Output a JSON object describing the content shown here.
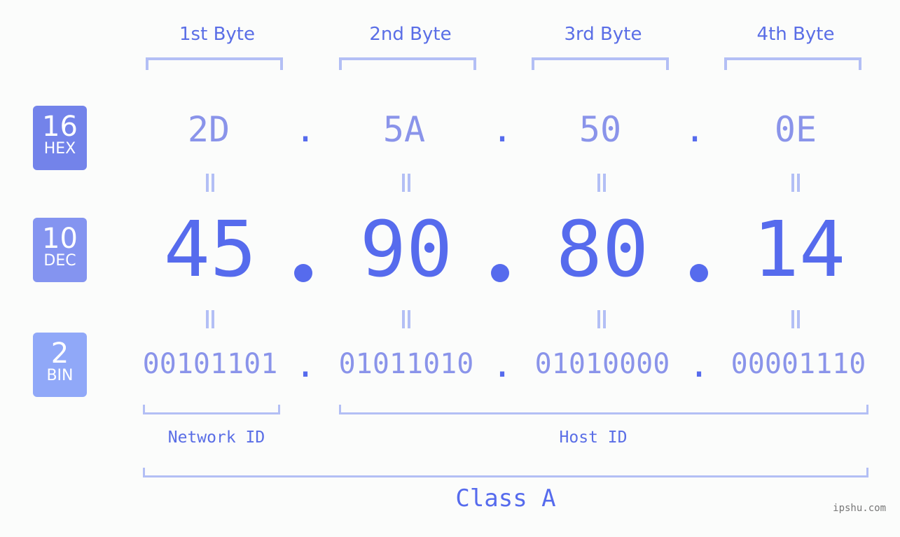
{
  "bytes": [
    {
      "label": "1st Byte",
      "hex": "2D",
      "dec": "45",
      "bin": "00101101"
    },
    {
      "label": "2nd Byte",
      "hex": "5A",
      "dec": "90",
      "bin": "01011010"
    },
    {
      "label": "3rd Byte",
      "hex": "50",
      "dec": "80",
      "bin": "01010000"
    },
    {
      "label": "4th Byte",
      "hex": "0E",
      "dec": "14",
      "bin": "00001110"
    }
  ],
  "badges": {
    "hex": {
      "num": "16",
      "label": "HEX",
      "color": "#7383ea"
    },
    "dec": {
      "num": "10",
      "label": "DEC",
      "color": "#8494f0"
    },
    "bin": {
      "num": "2",
      "label": "BIN",
      "color": "#90a8f8"
    }
  },
  "separator": ".",
  "network_id_label": "Network ID",
  "host_id_label": "Host ID",
  "class_label": "Class A",
  "watermark": "ipshu.com",
  "colors": {
    "accent": "#566bed",
    "light": "#8a94ea",
    "bracket": "#b3bff5"
  }
}
